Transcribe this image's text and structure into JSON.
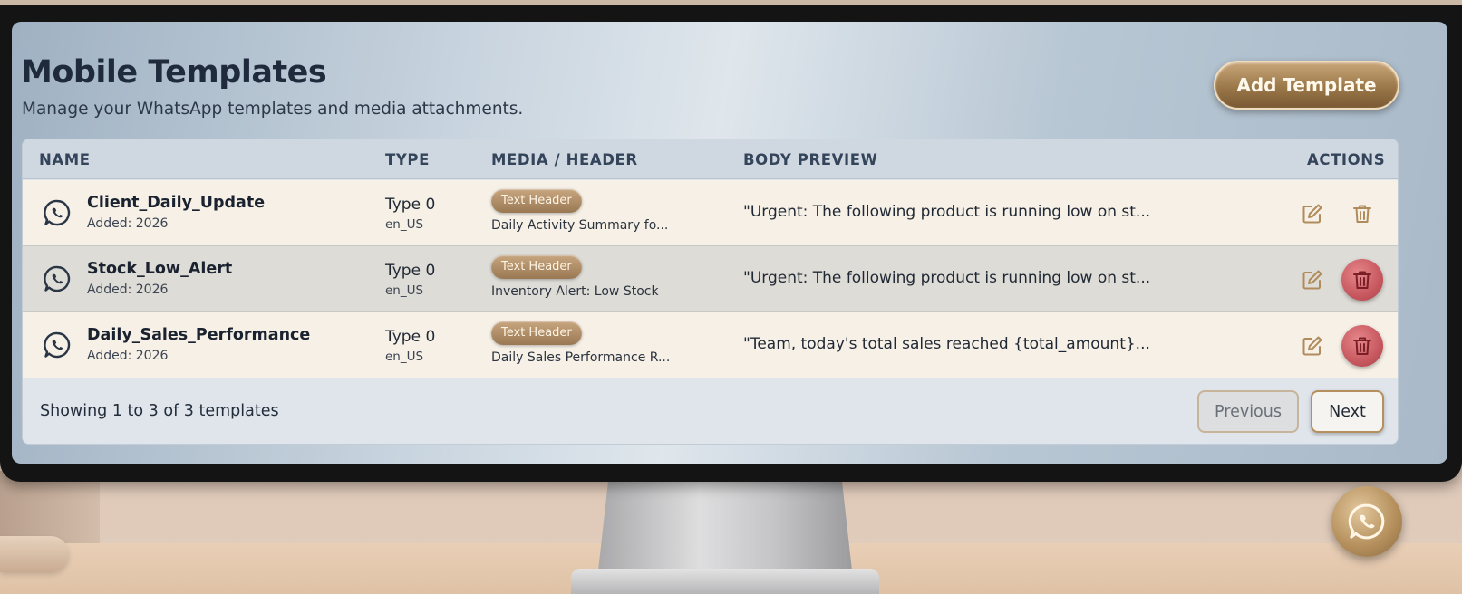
{
  "header": {
    "title": "Mobile Templates",
    "subtitle": "Manage your WhatsApp templates and media attachments.",
    "add_button": "Add Template"
  },
  "table": {
    "columns": [
      "NAME",
      "TYPE",
      "MEDIA / HEADER",
      "BODY PREVIEW",
      "ACTIONS"
    ],
    "rows": [
      {
        "name": "Client_Daily_Update",
        "added": "Added: 2026",
        "type": "Type 0",
        "lang": "en_US",
        "badge": "Text Header",
        "media": "Daily Activity Summary fo...",
        "body": "\"Urgent: The following product is running low on st..."
      },
      {
        "name": "Stock_Low_Alert",
        "added": "Added: 2026",
        "type": "Type 0",
        "lang": "en_US",
        "badge": "Text Header",
        "media": "Inventory Alert: Low Stock",
        "body": "\"Urgent: The following product is running low on st..."
      },
      {
        "name": "Daily_Sales_Performance",
        "added": "Added: 2026",
        "type": "Type 0",
        "lang": "en_US",
        "badge": "Text Header",
        "media": "Daily Sales Performance R...",
        "body": "\"Team, today's total sales reached {total_amount}..."
      }
    ]
  },
  "footer": {
    "showing": "Showing 1 to 3 of 3 templates",
    "previous": "Previous",
    "next": "Next"
  },
  "icons": {
    "row_icon": "whatsapp-icon",
    "edit": "edit-icon",
    "delete": "trash-icon",
    "fab": "whatsapp-icon"
  },
  "colors": {
    "title": "#1f2b3c",
    "accent_gold": "#9b7849",
    "delete_red": "#c75860"
  }
}
